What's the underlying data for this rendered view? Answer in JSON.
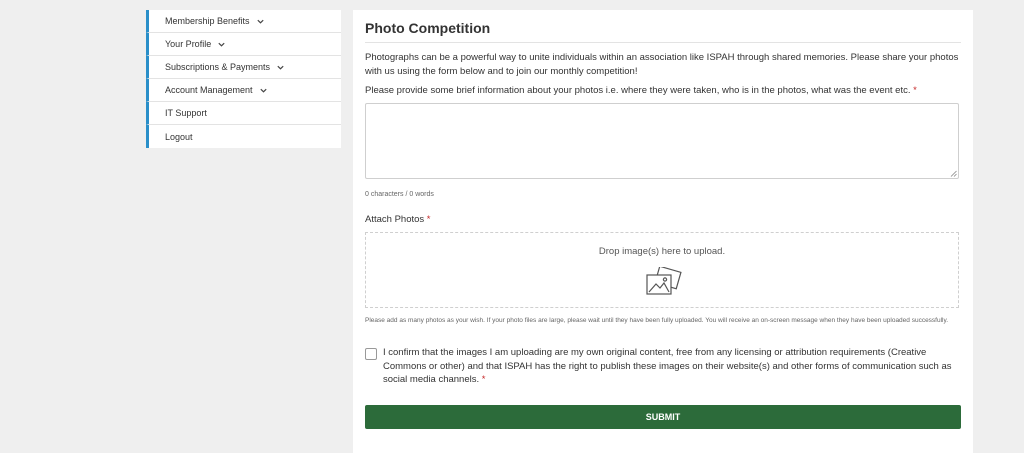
{
  "sidebar": {
    "items": [
      {
        "label": "Membership Benefits",
        "has_chevron": true
      },
      {
        "label": "Your Profile",
        "has_chevron": true
      },
      {
        "label": "Subscriptions & Payments",
        "has_chevron": true
      },
      {
        "label": "Account Management",
        "has_chevron": true
      },
      {
        "label": "IT Support",
        "has_chevron": false
      },
      {
        "label": "Logout",
        "has_chevron": false
      }
    ]
  },
  "form": {
    "title": "Photo Competition",
    "intro": "Photographs can be a powerful way to unite individuals within an association like ISPAH through shared memories. Please share your photos with us using the form below and to join our monthly competition!",
    "description_label": "Please provide some brief information about your photos i.e. where they were taken, who is in the photos, what was the event etc.",
    "description_value": "",
    "counter": "0 characters / 0 words",
    "attach_label": "Attach Photos",
    "drop_text": "Drop image(s) here to upload.",
    "help_text": "Please add as many photos as your wish. If your photo files are large, please wait until they have been fully uploaded. You will receive an on-screen message when they have been uploaded successfully.",
    "confirm_text": "I confirm that the images I am uploading are my own original content, free from any licensing or attribution requirements (Creative Commons or other) and that ISPAH has the right to publish these images on their website(s) and other forms of communication such as social media channels.",
    "required_mark": "*",
    "submit_label": "SUBMIT"
  },
  "colors": {
    "sidebar_accent": "#2a8fc9",
    "submit_bg": "#2c6b3a",
    "required": "#c62828",
    "page_bg": "#efefef"
  },
  "icons": [
    "chevron-down-icon",
    "image-upload-icon",
    "resize-grip-icon"
  ]
}
